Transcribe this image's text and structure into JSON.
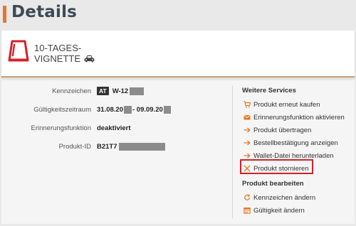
{
  "page": {
    "title": "Details"
  },
  "product": {
    "name_line1": "10-TAGES-",
    "name_line2": "VIGNETTE"
  },
  "details": [
    {
      "label": "Kennzeichen",
      "badge": "AT",
      "value": "W-12"
    },
    {
      "label": "Gültigkeitszeitraum",
      "value_a": "31.08.20",
      "value_b": "- 09.09.20"
    },
    {
      "label": "Erinnerungsfunktion",
      "value": "deaktiviert"
    },
    {
      "label": "Produkt-ID",
      "value": "B21T7"
    }
  ],
  "services": {
    "heading": "Weitere Services",
    "items": [
      {
        "label": "Produkt erneut kaufen",
        "icon": "cart-icon"
      },
      {
        "label": "Erinnerungsfunktion aktivieren",
        "icon": "envelope-icon"
      },
      {
        "label": "Produkt übertragen",
        "icon": "arrow-right-icon"
      },
      {
        "label": "Bestellbestätigung anzeigen",
        "icon": "arrow-right-icon"
      },
      {
        "label": "Wallet-Datei herunterladen",
        "icon": "arrow-right-icon"
      },
      {
        "label": "Produkt stornieren",
        "icon": "close-icon"
      }
    ]
  },
  "edit": {
    "heading": "Produkt bearbeiten",
    "items": [
      {
        "label": "Kennzeichen ändern",
        "icon": "refresh-icon"
      },
      {
        "label": "Gültigkeit ändern",
        "icon": "calendar-icon"
      }
    ]
  },
  "colors": {
    "accent": "#e87722",
    "brand_red": "#d6202a",
    "title": "#3d4a57"
  }
}
